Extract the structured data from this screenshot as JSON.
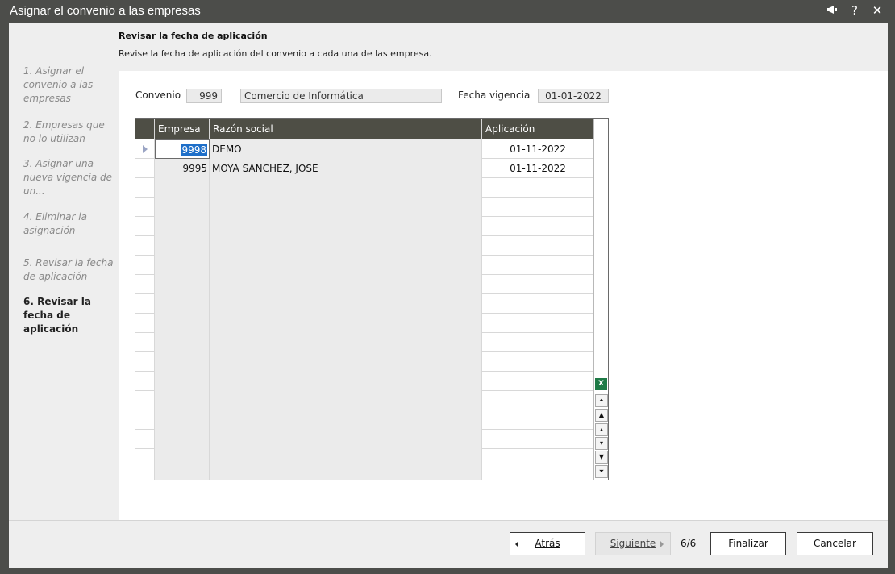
{
  "window": {
    "title": "Asignar el convenio a las empresas"
  },
  "header": {
    "title": "Revisar la fecha de aplicación",
    "description": "Revise la fecha de aplicación del convenio a cada una de las empresa."
  },
  "steps": [
    "1. Asignar el convenio a las empresas",
    "2. Empresas que no lo utilizan",
    "3. Asignar una nueva vigencia de un...",
    "4. Eliminar la asignación",
    "5. Revisar la fecha de aplicación",
    "6. Revisar la fecha de aplicación"
  ],
  "form": {
    "convenio_label": "Convenio",
    "convenio_code": "999",
    "convenio_name": "Comercio de Informática",
    "fecha_label": "Fecha vigencia",
    "fecha_value": "01-01-2022"
  },
  "grid": {
    "columns": [
      "Empresa",
      "Razón social",
      "Aplicación"
    ],
    "rows": [
      {
        "empresa": "9998",
        "razon": "DEMO",
        "aplicacion": "01-11-2022"
      },
      {
        "empresa": "9995",
        "razon": "MOYA SANCHEZ, JOSE",
        "aplicacion": "01-11-2022"
      }
    ],
    "excel_label": "X"
  },
  "footer": {
    "back_label": "Atrás",
    "next_label": "Siguiente",
    "counter": "6/6",
    "finish_label": "Finalizar",
    "cancel_label": "Cancelar"
  }
}
